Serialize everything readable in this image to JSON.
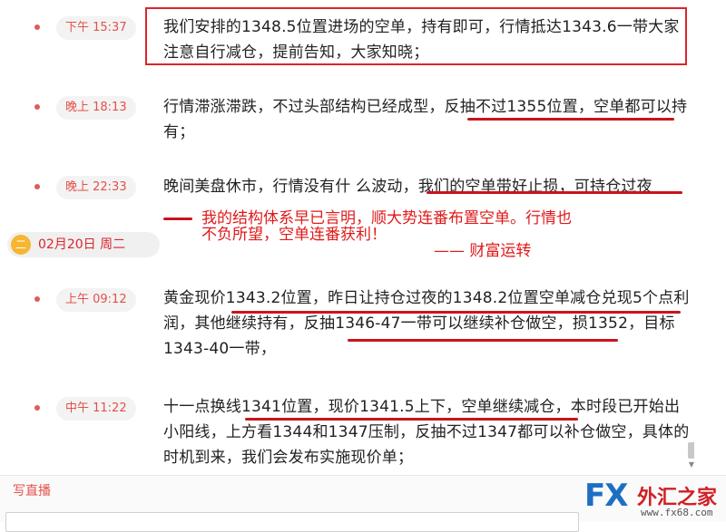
{
  "feed": {
    "entries": [
      {
        "time": "下午 15:37",
        "text": "我们安排的1348.5位置进场的空单，持有即可，行情抵达1343.6一带大家注意自行减仓，提前告知，大家知晓；"
      },
      {
        "time": "晚上 18:13",
        "text": "行情滞涨滞跌，不过头部结构已经成型，反抽不过1355位置，空单都可以持有；"
      },
      {
        "time": "晚上 22:33",
        "text": "晚间美盘休市，行情没有什 么波动，我们的空单带好止损，可持仓过夜"
      },
      {
        "time": "上午 09:12",
        "text": "黄金现价1343.2位置，昨日让持仓过夜的1348.2位置空单减仓兑现5个点利润，其他继续持有，反抽1346-47一带可以继续补仓做空，损1352，目标1343-40一带，"
      },
      {
        "time": "中午 11:22",
        "text": "十一点换线1341位置，现价1341.5上下，空单继续减仓，本时段已开始出小阳线，上方看1344和1347压制，反抽不过1347都可以补仓做空，具体的时机到来，我们会发布实施现价单；"
      }
    ],
    "date_divider": {
      "icon": "二",
      "date": "02月20日 周二"
    },
    "annotation": {
      "line1": "我的结构体系早已言明，顺大势连番布置空单。行情也",
      "line2": "不负所望，空单连番获利！",
      "signature": "——   财富运转"
    }
  },
  "compose": {
    "label": "写直播",
    "placeholder": ""
  },
  "logo": {
    "fx": "FX",
    "cn": "外汇之家",
    "url": "www.fx68.com"
  },
  "colors": {
    "accent": "#e4504a",
    "annotation": "#e01919",
    "underline": "#c9141b",
    "logo_blue": "#1d6fc4",
    "logo_red": "#d11f25"
  }
}
